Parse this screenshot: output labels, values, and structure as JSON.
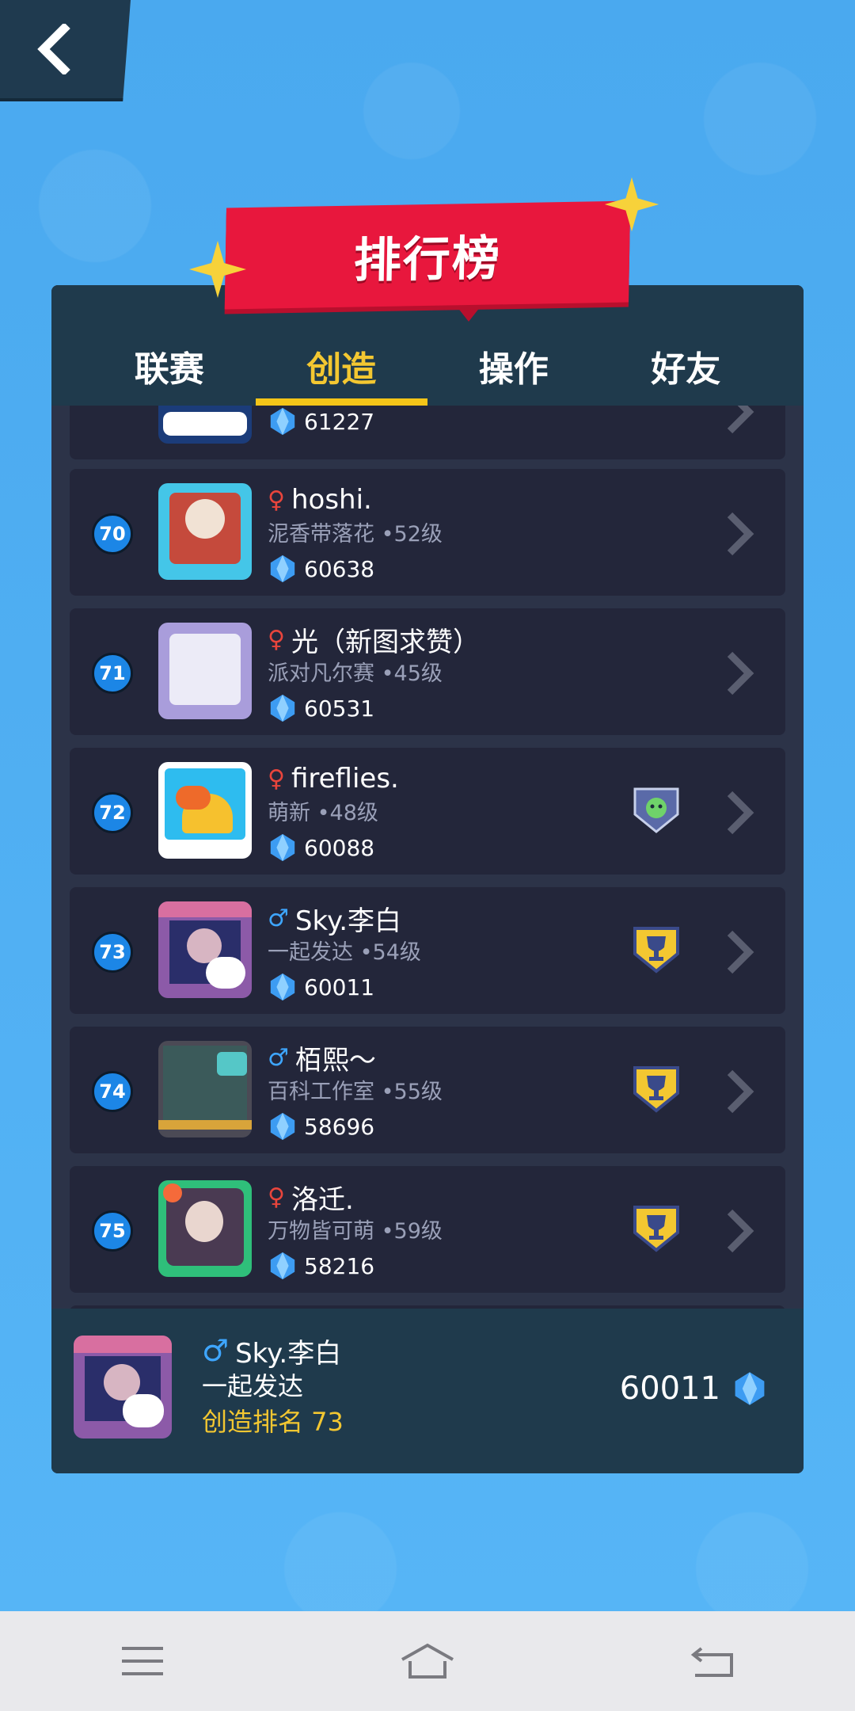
{
  "header": {
    "title": "排行榜"
  },
  "tabs": [
    {
      "label": "联赛",
      "active": false
    },
    {
      "label": "创造",
      "active": true
    },
    {
      "label": "操作",
      "active": false
    },
    {
      "label": "好友",
      "active": false
    }
  ],
  "partial_row": {
    "score": "61227"
  },
  "rows": [
    {
      "rank": "70",
      "gender": "♀",
      "name": "hoshi.",
      "club": "泥香带落花",
      "level": "•52级",
      "score": "60638",
      "badge": ""
    },
    {
      "rank": "71",
      "gender": "♀",
      "name": "光（新图求赞）",
      "club": "派对凡尔赛",
      "level": "•45级",
      "score": "60531",
      "badge": ""
    },
    {
      "rank": "72",
      "gender": "♀",
      "name": "fireflies.",
      "club": "萌新",
      "level": "•48级",
      "score": "60088",
      "badge": "shield-icon"
    },
    {
      "rank": "73",
      "gender": "♂",
      "name": "Sky.李白",
      "club": "一起发达",
      "level": "•54级",
      "score": "60011",
      "badge": "trophy-icon"
    },
    {
      "rank": "74",
      "gender": "♂",
      "name": "栢熙～",
      "club": "百科工作室",
      "level": "•55级",
      "score": "58696",
      "badge": "trophy-icon"
    },
    {
      "rank": "75",
      "gender": "♀",
      "name": "洛迁.",
      "club": "万物皆可萌",
      "level": "•59级",
      "score": "58216",
      "badge": "trophy-icon"
    }
  ],
  "me": {
    "gender": "♂",
    "name": "Sky.李白",
    "club": "一起发达",
    "rank_text": "创造排名 73",
    "score": "60011"
  },
  "colors": {
    "background": "#4aa8ee",
    "panel": "#2c3348",
    "row": "#23263a",
    "accent": "#f3c731",
    "ribbon": "#e8173d",
    "rank_badge": "#1c86e6"
  }
}
